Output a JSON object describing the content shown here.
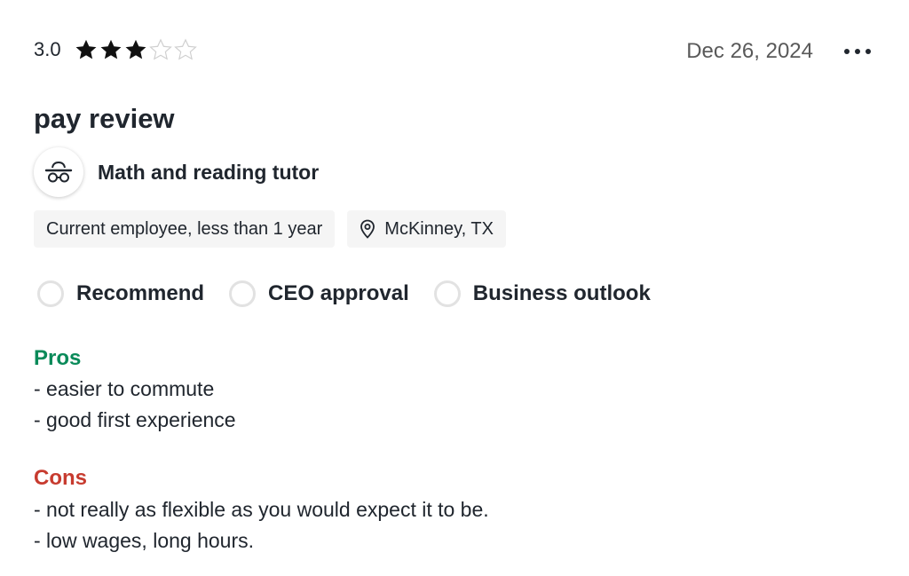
{
  "review": {
    "rating": "3.0",
    "rating_value": 3,
    "rating_max": 5,
    "date": "Dec 26, 2024",
    "title": "pay review",
    "job_title": "Math and reading tutor",
    "employment": "Current employee, less than 1 year",
    "location": "McKinney, TX",
    "indicators": [
      {
        "label": "Recommend",
        "state": "none"
      },
      {
        "label": "CEO approval",
        "state": "none"
      },
      {
        "label": "Business outlook",
        "state": "none"
      }
    ],
    "pros": {
      "heading": "Pros",
      "lines": [
        "- easier to commute",
        "- good first experience"
      ]
    },
    "cons": {
      "heading": "Cons",
      "lines": [
        "- not really as flexible as you would expect it to be.",
        "- low wages, long hours."
      ]
    }
  },
  "icons": {
    "star_filled": "star-filled-icon",
    "star_empty": "star-empty-icon",
    "more": "more-options-icon",
    "avatar": "anonymous-user-icon",
    "location": "location-pin-icon"
  },
  "colors": {
    "text": "#20262e",
    "muted": "#595959",
    "pros": "#0a8a59",
    "cons": "#c73b2f",
    "tag_bg": "#f5f5f5",
    "circle_border": "#e2e2e2"
  }
}
